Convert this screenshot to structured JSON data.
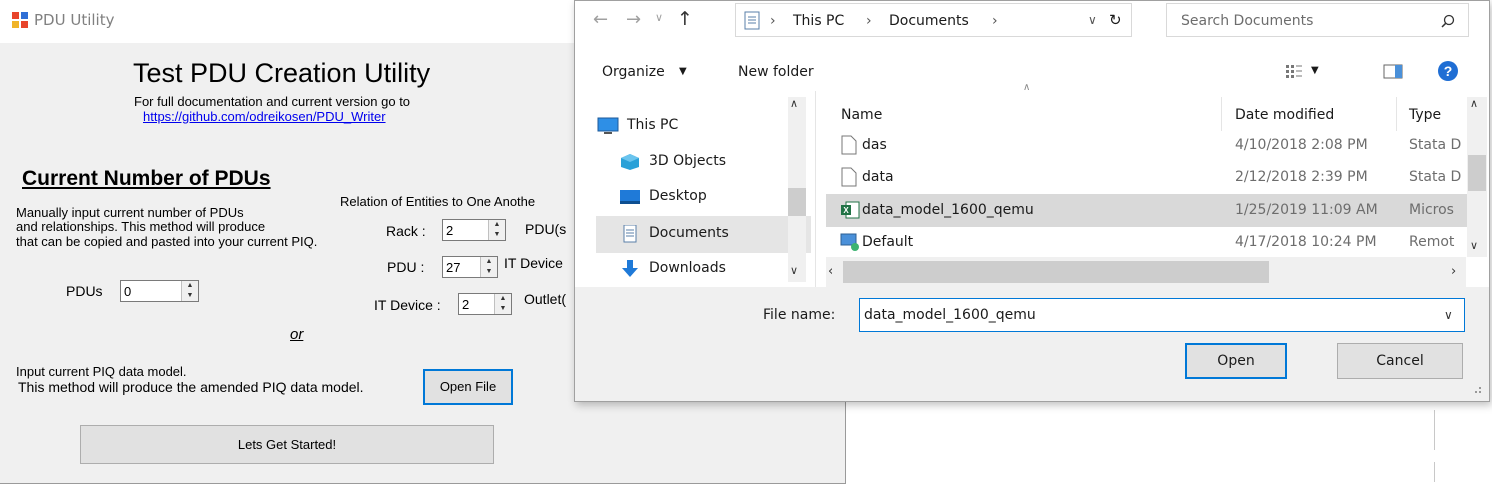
{
  "pdu_window": {
    "title": "PDU Utility",
    "heading": "Test PDU Creation Utility",
    "doc_line": "For full documentation and current version go to",
    "doc_link": "https://github.com/odreikosen/PDU_Writer",
    "section_title": "Current Number of PDUs",
    "description_lines": [
      "Manually input current number of PDUs",
      "and relationships. This method will produce",
      "that can be copied and pasted into your current PIQ."
    ],
    "relation_label": "Relation of Entities to One Anothe",
    "rack_label": "Rack :",
    "rack_value": "2",
    "rack_unit": "PDU(s",
    "pdu_label": "PDU :",
    "pdu_value": "27",
    "pdu_unit": "IT Device",
    "it_device_label": "IT Device :",
    "it_device_value": "2",
    "it_device_unit": "Outlet(",
    "pdus_label": "PDUs",
    "pdus_value": "0",
    "or_label": "or",
    "input_lines": [
      "Input current PIQ data model.",
      "This method will produce the amended PIQ data model."
    ],
    "open_file_button": "Open File",
    "start_button": "Lets Get Started!"
  },
  "dialog": {
    "breadcrumb": [
      "This PC",
      "Documents"
    ],
    "search_placeholder": "Search Documents",
    "toolbar": {
      "organize": "Organize",
      "new_folder": "New folder"
    },
    "nav_items": [
      "This PC",
      "3D Objects",
      "Desktop",
      "Documents",
      "Downloads"
    ],
    "columns": {
      "name": "Name",
      "date": "Date modified",
      "type": "Type"
    },
    "files": [
      {
        "name": "das",
        "date": "4/10/2018 2:08 PM",
        "type": "Stata D"
      },
      {
        "name": "data",
        "date": "2/12/2018 2:39 PM",
        "type": "Stata D"
      },
      {
        "name": "data_model_1600_qemu",
        "date": "1/25/2019 11:09 AM",
        "type": "Micros"
      },
      {
        "name": "Default",
        "date": "4/17/2018 10:24 PM",
        "type": "Remot"
      }
    ],
    "filename_label": "File name:",
    "filename_value": "data_model_1600_qemu",
    "open_button": "Open",
    "cancel_button": "Cancel"
  }
}
